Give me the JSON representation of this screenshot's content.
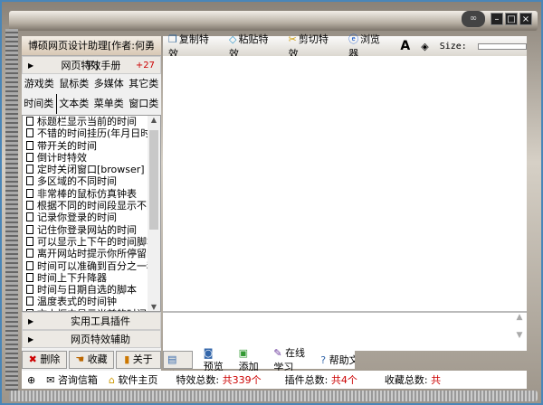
{
  "window": {
    "controls": [
      "minimize",
      "maximize",
      "close"
    ]
  },
  "sidebar": {
    "title": "博硕网页设计助理[作者:何勇平]",
    "manual": {
      "label": "网页特效手册",
      "count": "+27"
    },
    "categories": [
      "游戏类",
      "鼠标类",
      "多媒体",
      "其它类",
      "时间类",
      "文本类",
      "菜单类",
      "窗口类"
    ],
    "items": [
      "标题栏显示当前的时间",
      "不错的时间挂历(年月日时间",
      "带开关的时间",
      "倒计时特效",
      "定时关闭窗口[browser]",
      "多区域的不同时间",
      "非常棒的鼠标仿真钟表",
      "根据不同的时间段显示不同",
      "记录你登录的时间",
      "记住你登录网站的时间",
      "可以显示上下午的时间脚本",
      "离开网站时提示你所停留的",
      "时间可以准确到百分之一秒",
      "时间上下升降器",
      "时间与日期自选的脚本",
      "温度表式的时间钟",
      "文本框中显示当前的时间"
    ],
    "tools": "实用工具插件",
    "assist": "网页特效辅助",
    "buttons": [
      "删除",
      "收藏",
      "关于"
    ]
  },
  "toolbar": {
    "copy": "复制特效",
    "paste": "粘贴特效",
    "cut": "剪切特效",
    "browser": "浏览器",
    "size_label": "Size:"
  },
  "tabs": [
    "代码",
    "预览",
    "添加",
    "在线学习",
    "帮助文档"
  ],
  "status": {
    "mail": "咨询信箱",
    "home": "软件主页",
    "effects_label": "特效总数:",
    "effects_value": "共339个",
    "plugins_label": "插件总数:",
    "plugins_value": "共4个",
    "fav_label": "收藏总数:",
    "fav_value": "共"
  }
}
